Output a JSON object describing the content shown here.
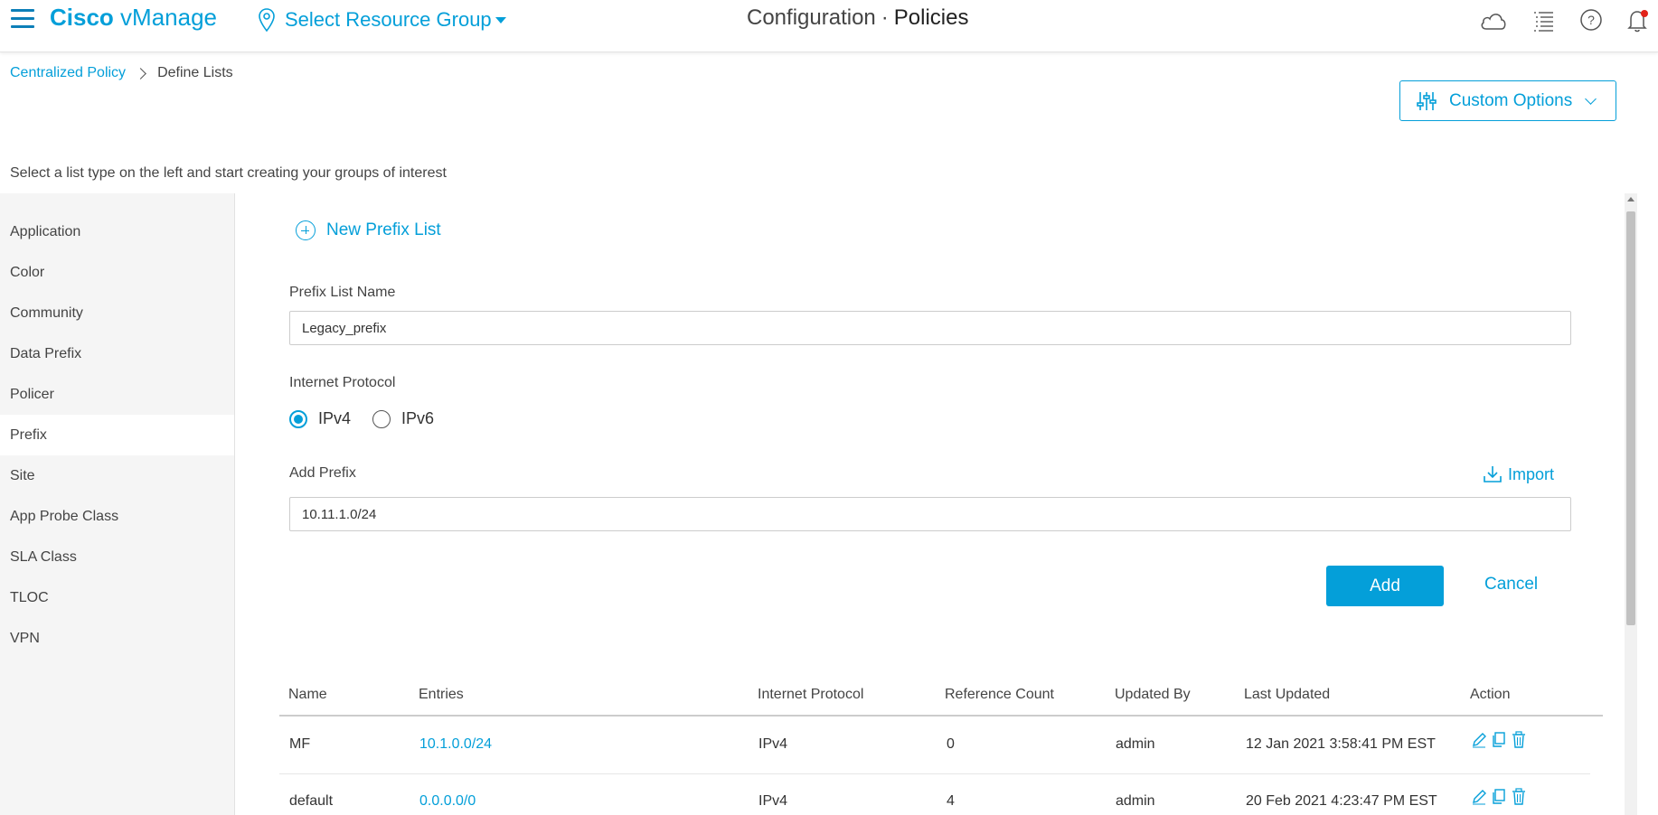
{
  "header": {
    "brand_bold": "Cisco",
    "brand_rest": " vManage",
    "resource_group": "Select Resource Group",
    "title_section": "Configuration",
    "title_separator": "·",
    "title_page": "Policies",
    "icons": [
      "menu-icon",
      "location-pin-icon",
      "cloud-icon",
      "list-icon",
      "help-icon",
      "bell-icon"
    ]
  },
  "breadcrumb": {
    "parent": "Centralized Policy",
    "current": "Define Lists"
  },
  "custom_options_label": "Custom Options",
  "intro_text": "Select a list type on the left and start creating your groups of interest",
  "sidebar": {
    "items": [
      {
        "label": "Application"
      },
      {
        "label": "Color"
      },
      {
        "label": "Community"
      },
      {
        "label": "Data Prefix"
      },
      {
        "label": "Policer"
      },
      {
        "label": "Prefix"
      },
      {
        "label": "Site"
      },
      {
        "label": "App Probe Class"
      },
      {
        "label": "SLA Class"
      },
      {
        "label": "TLOC"
      },
      {
        "label": "VPN"
      }
    ],
    "active": "Prefix"
  },
  "form": {
    "new_list_label": "New Prefix List",
    "name_label": "Prefix List Name",
    "name_value": "Legacy_prefix",
    "protocol_label": "Internet Protocol",
    "protocol_options": [
      "IPv4",
      "IPv6"
    ],
    "protocol_selected": "IPv4",
    "add_prefix_label": "Add Prefix",
    "add_prefix_value": "10.11.1.0/24",
    "import_label": "Import",
    "add_button": "Add",
    "cancel_button": "Cancel"
  },
  "table": {
    "columns": [
      "Name",
      "Entries",
      "Internet Protocol",
      "Reference Count",
      "Updated By",
      "Last Updated",
      "Action"
    ],
    "rows": [
      {
        "name": "MF",
        "entries": "10.1.0.0/24",
        "protocol": "IPv4",
        "ref_count": "0",
        "updated_by": "admin",
        "last_updated": "12 Jan 2021 3:58:41 PM EST"
      },
      {
        "name": "default",
        "entries": "0.0.0.0/0",
        "protocol": "IPv4",
        "ref_count": "4",
        "updated_by": "admin",
        "last_updated": "20 Feb 2021 4:23:47 PM EST"
      }
    ],
    "action_icons": [
      "edit-icon",
      "copy-icon",
      "delete-icon"
    ]
  },
  "colors": {
    "accent": "#049fd9",
    "sidebar_bg": "#f5f5f5",
    "text": "#333333",
    "notification_dot": "#e2231a"
  }
}
